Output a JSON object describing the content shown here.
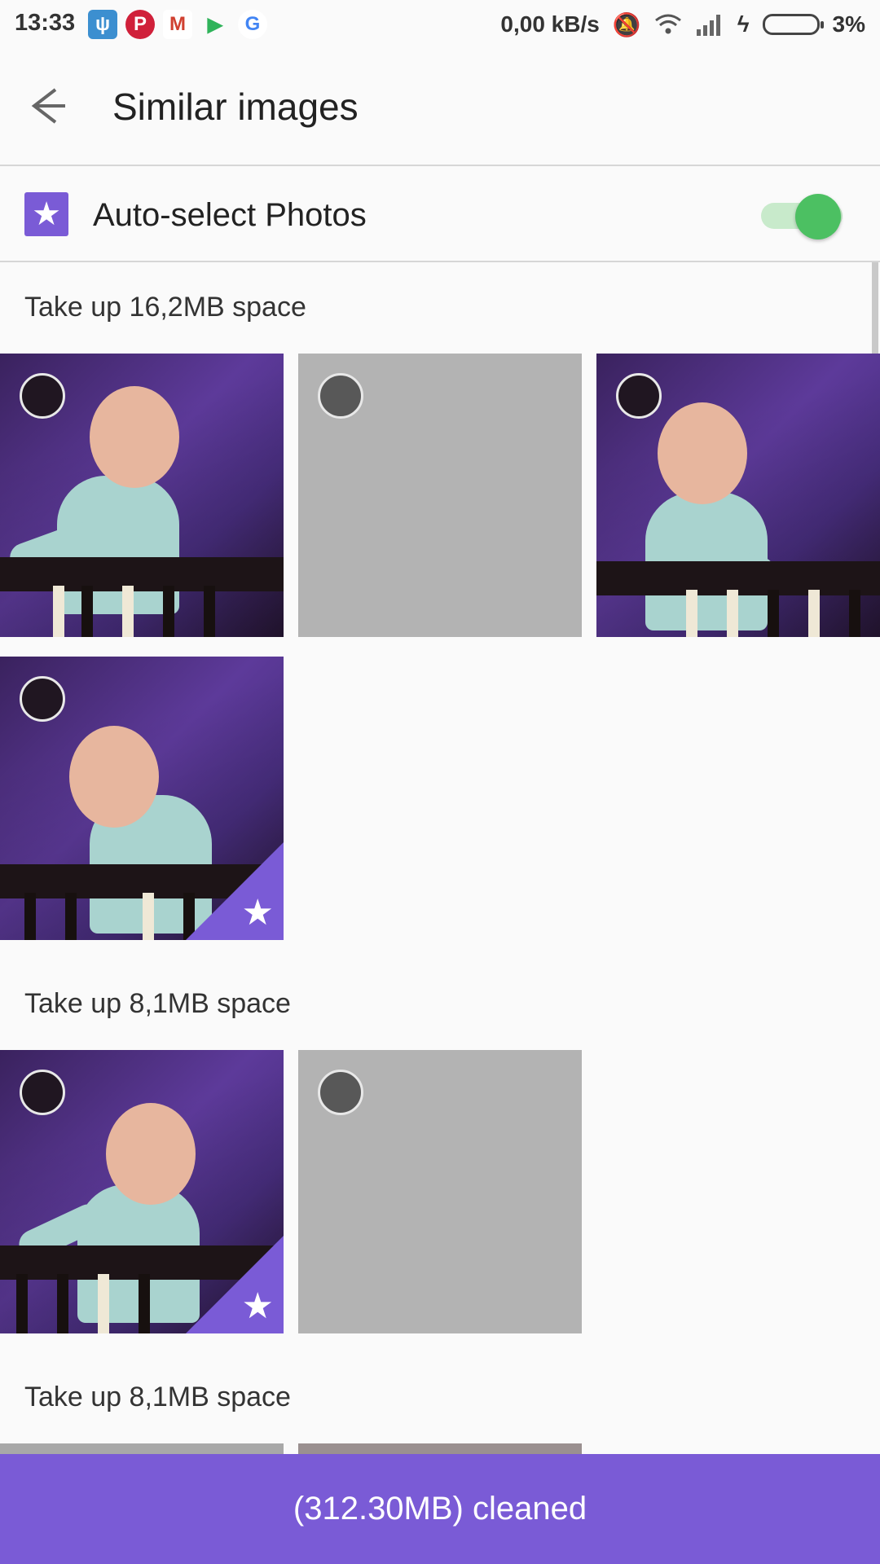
{
  "status_bar": {
    "time": "13:33",
    "app_icons": [
      "usb-icon",
      "pinterest-icon",
      "gmail-icon",
      "play-store-icon",
      "google-icon"
    ],
    "net_speed": "0,00 kB/s",
    "battery": "3%"
  },
  "app_bar": {
    "title": "Similar images"
  },
  "auto_select": {
    "label": "Auto-select Photos",
    "enabled": true
  },
  "groups": [
    {
      "label": "Take up 16,2MB space"
    },
    {
      "label": "Take up 8,1MB space"
    },
    {
      "label": "Take up 8,1MB space"
    }
  ],
  "bottom_bar": {
    "label": "(312.30MB) cleaned"
  },
  "colors": {
    "accent": "#7a5bd6",
    "toggle_on": "#4cc062"
  }
}
